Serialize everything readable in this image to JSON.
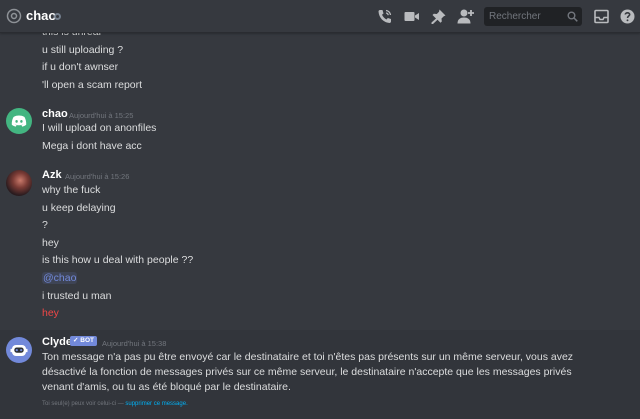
{
  "header": {
    "channel_name": "chao",
    "search_placeholder": "Rechercher"
  },
  "messages_top": [
    "this is unreal",
    "u still uploading  ?",
    "if u don't awnser",
    "'ll open a scam report"
  ],
  "chao_group": {
    "username": "chao",
    "timestamp": "Aujourd'hui à 15:25",
    "lines": [
      "I will upload on anonfiles",
      "Mega i dont have acc"
    ]
  },
  "azk_group": {
    "username": "Azk",
    "timestamp": "Aujourd'hui à 15:26",
    "lines": [
      "why the fuck",
      "u keep delaying",
      "?",
      "hey",
      "is this how u deal with people ??"
    ],
    "mention": "@chao",
    "line_after_mention": "i trusted u man",
    "last_line": "hey"
  },
  "clyde_group": {
    "username": "Clyde",
    "bot_tag": "✓ BOT",
    "timestamp": "Aujourd'hui à 15:38",
    "text": "Ton message n'a pas pu être envoyé car le destinataire et toi n'êtes pas présents sur un même serveur, vous avez désactivé la fonction de messages privés sur ce même serveur, le destinataire n'accepte que les messages privés venant d'amis, ou tu as été bloqué par le destinataire.",
    "ephemeral_note": "Toi seul(e) peux voir celui-ci —",
    "ephemeral_link": "supprimer ce message."
  },
  "colors": {
    "background": "#36393f",
    "blurple": "#7289da",
    "mention_red": "#f04747",
    "discord_green": "#43b581"
  },
  "icons": [
    "at-icon",
    "status-icon",
    "call-icon",
    "video-icon",
    "pin-icon",
    "add-friend-icon",
    "search-icon",
    "inbox-icon",
    "help-icon",
    "discord-logo-icon",
    "clyde-robot-icon"
  ]
}
